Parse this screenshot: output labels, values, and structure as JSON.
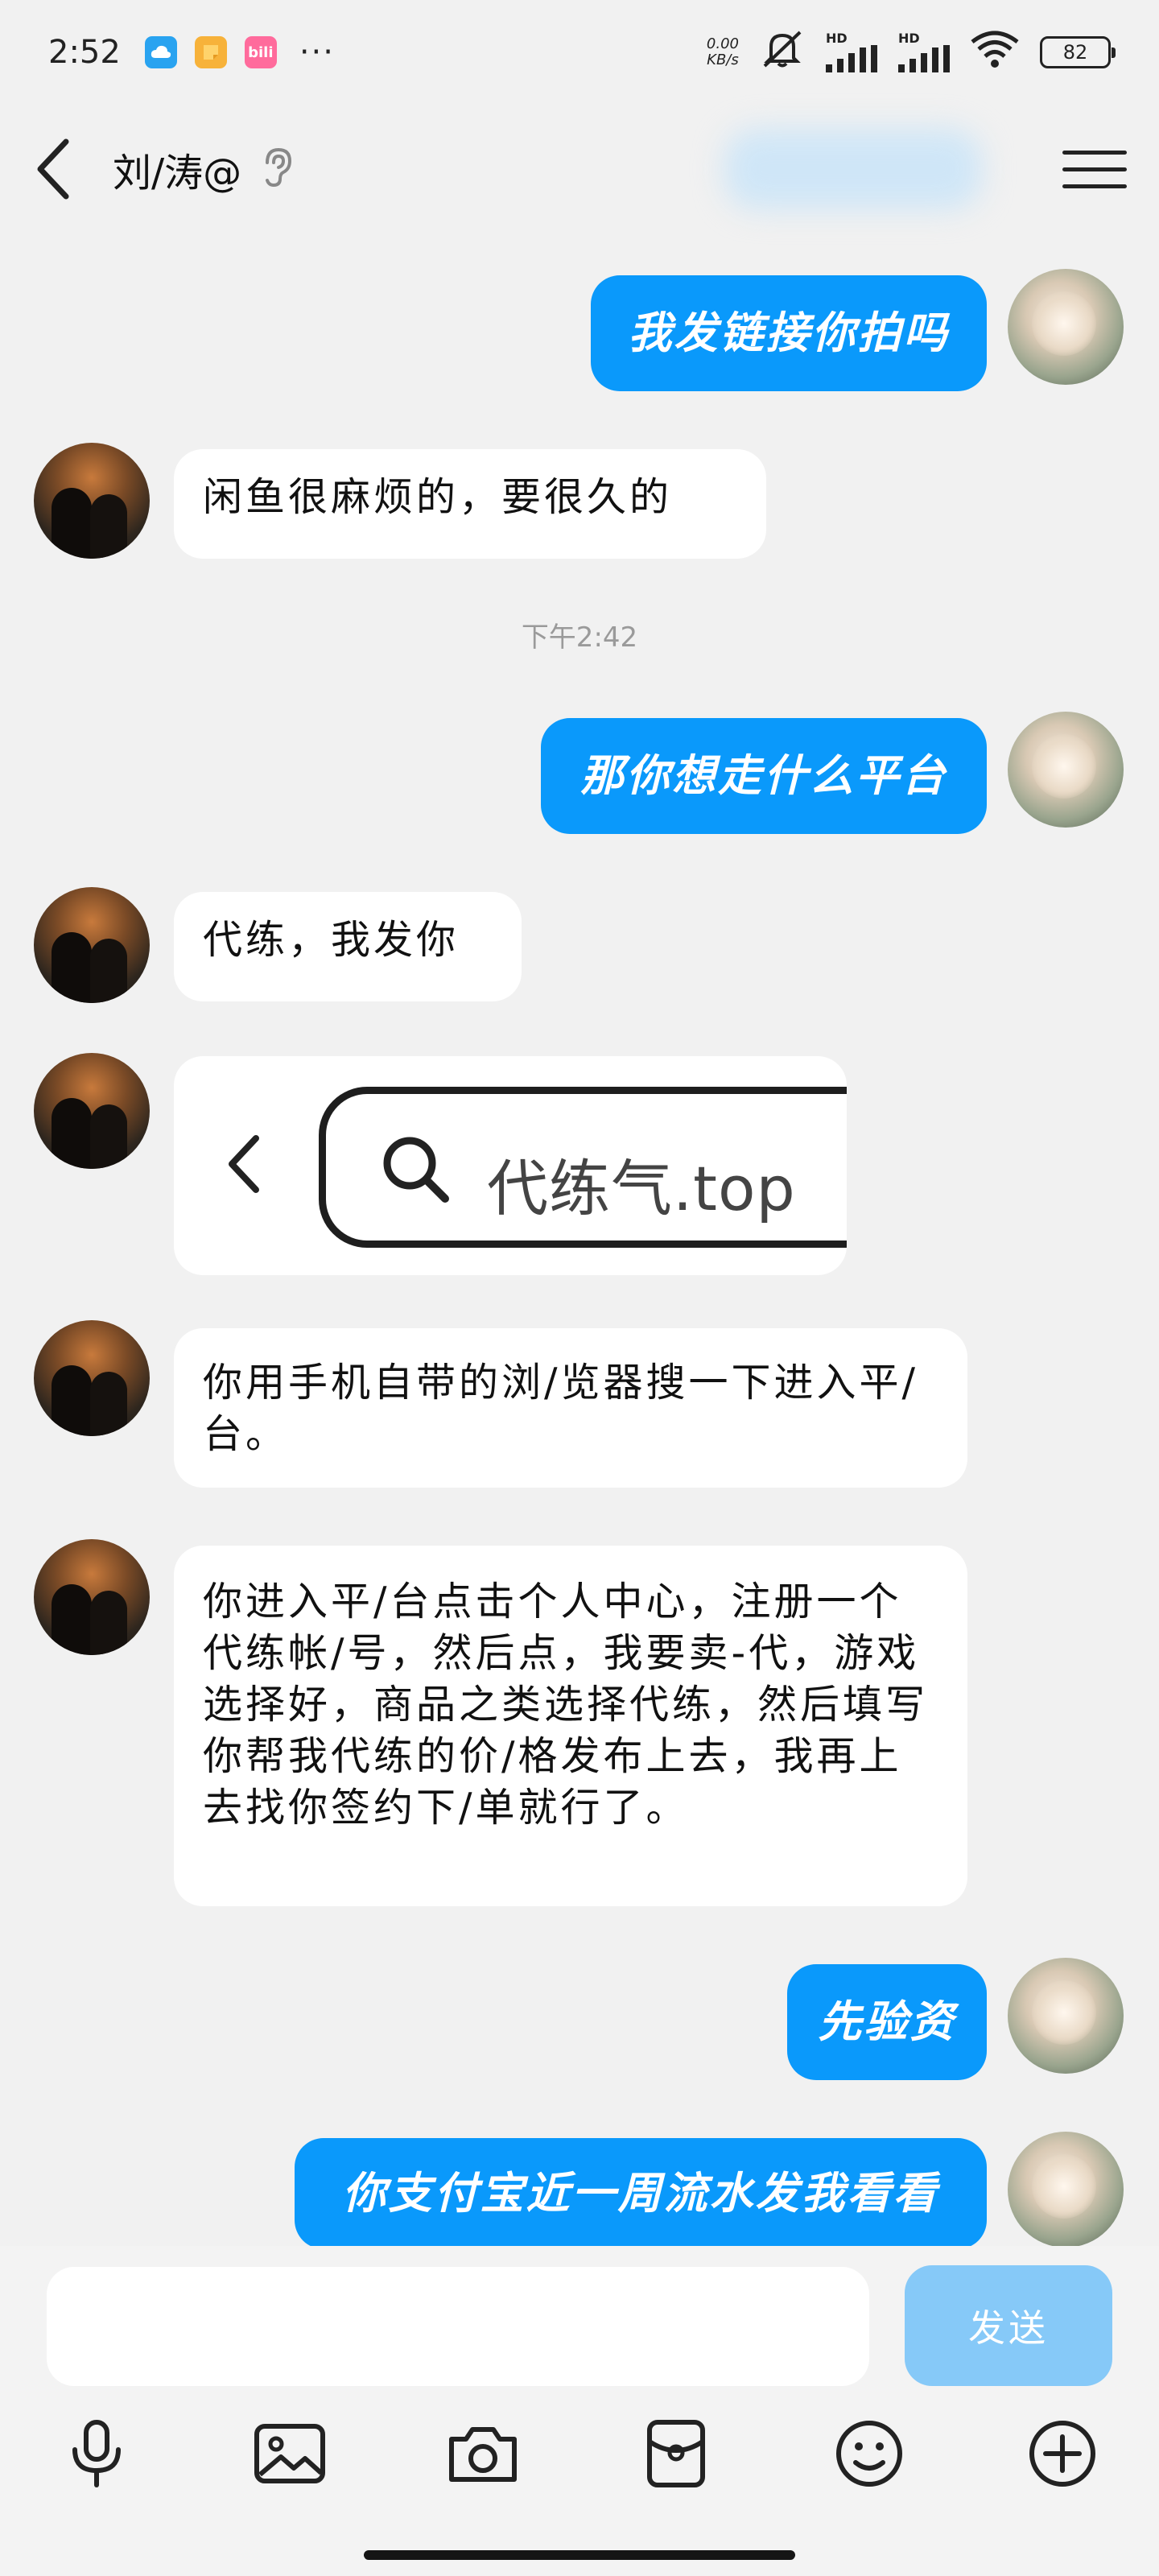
{
  "status_bar": {
    "time": "2:52",
    "more": "···",
    "net_speed_value": "0.00",
    "net_speed_unit": "KB/s",
    "signal_1": "HD",
    "signal_2": "HD",
    "battery": "82"
  },
  "header": {
    "title": "刘/涛@"
  },
  "messages": {
    "m1": "我发链接你拍吗",
    "m2": "闲鱼很麻烦的，要很久的",
    "timestamp": "下午2:42",
    "m3": "那你想走什么平台",
    "m4": "代练，我发你",
    "card_search_text": "代练气.top",
    "m5": "你用手机自带的浏/览器搜一下进入平/台。",
    "m6": "你进入平/台点击个人中心，注册一个代练帐/号，然后点，我要卖-代，游戏选择好，商品之类选择代练，然后填写你帮我代练的价/格发布上去，我再上去找你签约下/单就行了。",
    "m7": "先验资",
    "m8": "你支付宝近一周流水发我看看"
  },
  "composer": {
    "send_label": "发送",
    "input_value": ""
  },
  "colors": {
    "outgoing_bubble": "#0a99fb",
    "incoming_bubble": "#ffffff",
    "send_button_disabled": "#86c9f8",
    "background": "#f1f1f1"
  }
}
